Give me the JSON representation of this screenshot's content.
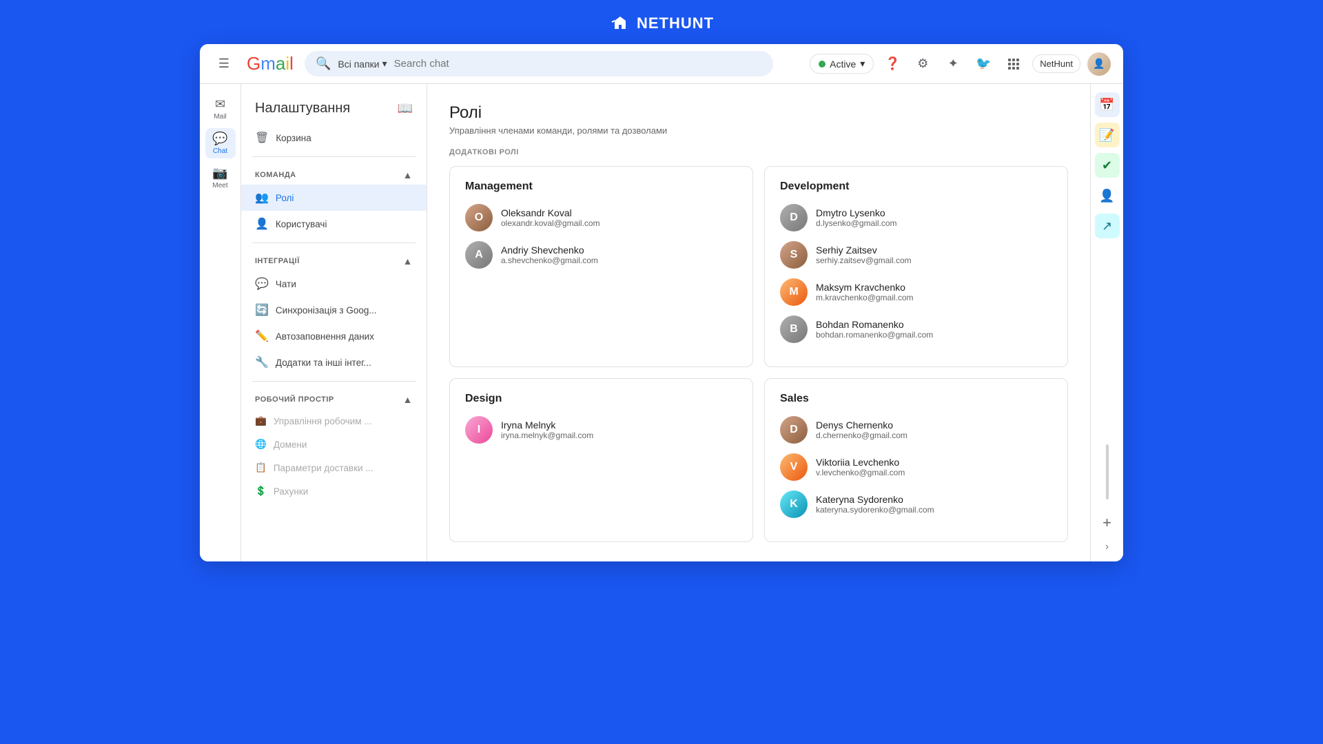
{
  "topbar": {
    "logo_text": "NETHUNT"
  },
  "header": {
    "menu_label": "☰",
    "gmail_label": "Gmail",
    "folder_select": "Всі папки",
    "search_placeholder": "Search chat",
    "active_label": "Active",
    "help_icon": "?",
    "settings_icon": "⚙",
    "star_icon": "★",
    "nethunt_btn": "NetHunt",
    "apps_icon": "⋮⋮⋮"
  },
  "left_nav": {
    "items": [
      {
        "icon": "✉",
        "label": "Mail",
        "active": false
      },
      {
        "icon": "💬",
        "label": "Chat",
        "active": true
      },
      {
        "icon": "📷",
        "label": "Meet",
        "active": false
      }
    ]
  },
  "nav_sidebar": {
    "title": "Налаштування",
    "sections": [
      {
        "id": "team",
        "label": "КОМАНДА",
        "items": [
          {
            "id": "roles",
            "icon": "👥",
            "label": "Ролі",
            "active": true
          },
          {
            "id": "users",
            "icon": "👤",
            "label": "Користувачі",
            "active": false
          }
        ]
      },
      {
        "id": "integrations",
        "label": "ІНТЕГРАЦІЇ",
        "items": [
          {
            "id": "chats",
            "icon": "💬",
            "label": "Чати",
            "active": false
          },
          {
            "id": "sync",
            "icon": "🔄",
            "label": "Синхронізація з Goog...",
            "active": false
          },
          {
            "id": "autofill",
            "icon": "✏️",
            "label": "Автозаповнення даних",
            "active": false
          },
          {
            "id": "addons",
            "icon": "🔧",
            "label": "Додатки та інші інтег...",
            "active": false
          }
        ]
      },
      {
        "id": "workspace",
        "label": "РОБОЧИЙ ПРОСТІР",
        "items": [
          {
            "id": "manage",
            "icon": "💼",
            "label": "Управління робочим ...",
            "active": false,
            "disabled": true
          },
          {
            "id": "domains",
            "icon": "🌐",
            "label": "Домени",
            "active": false,
            "disabled": true
          },
          {
            "id": "delivery",
            "icon": "📋",
            "label": "Параметри доставки ...",
            "active": false,
            "disabled": true
          },
          {
            "id": "billing",
            "icon": "💲",
            "label": "Рахунки",
            "active": false,
            "disabled": true
          }
        ]
      }
    ],
    "trash_label": "Корзина",
    "trash_icon": "🗑"
  },
  "main": {
    "page_title": "Ролі",
    "page_subtitle": "Управління членами команди, ролями та дозволами",
    "section_label": "ДОДАТКОВІ РОЛІ",
    "roles": [
      {
        "id": "management",
        "title": "Management",
        "members": [
          {
            "name": "Oleksandr Koval",
            "email": "olexandr.koval@gmail.com",
            "avatar_class": "av-brown"
          },
          {
            "name": "Andriy Shevchenko",
            "email": "a.shevchenko@gmail.com",
            "avatar_class": "av-gray"
          }
        ]
      },
      {
        "id": "development",
        "title": "Development",
        "members": [
          {
            "name": "Dmytro Lysenko",
            "email": "d.lysenko@gmail.com",
            "avatar_class": "av-gray"
          },
          {
            "name": "Serhiy Zaitsev",
            "email": "serhiy.zaitsev@gmail.com",
            "avatar_class": "av-brown"
          },
          {
            "name": "Maksym Kravchenko",
            "email": "m.kravchenko@gmail.com",
            "avatar_class": "av-orange"
          },
          {
            "name": "Bohdan Romanenko",
            "email": "bohdan.romanenko@gmail.com",
            "avatar_class": "av-gray"
          }
        ]
      },
      {
        "id": "design",
        "title": "Design",
        "members": [
          {
            "name": "Iryna Melnyk",
            "email": "iryna.melnyk@gmail.com",
            "avatar_class": "av-pink"
          }
        ]
      },
      {
        "id": "sales",
        "title": "Sales",
        "members": [
          {
            "name": "Denys Chernenko",
            "email": "d.chernenko@gmail.com",
            "avatar_class": "av-brown"
          },
          {
            "name": "Viktoriia Levchenko",
            "email": "v.levchenko@gmail.com",
            "avatar_class": "av-orange"
          },
          {
            "name": "Kateryna Sydorenko",
            "email": "kateryna.sydorenko@gmail.com",
            "avatar_class": "av-teal"
          }
        ]
      }
    ]
  },
  "right_sidebar": {
    "icons": [
      {
        "id": "calendar",
        "symbol": "📅",
        "class": ""
      },
      {
        "id": "note",
        "symbol": "📝",
        "class": "yellow"
      },
      {
        "id": "task",
        "symbol": "✔",
        "class": "blue"
      },
      {
        "id": "person",
        "symbol": "👤",
        "class": ""
      },
      {
        "id": "export",
        "symbol": "↗",
        "class": "teal"
      }
    ],
    "plus_label": "+"
  }
}
